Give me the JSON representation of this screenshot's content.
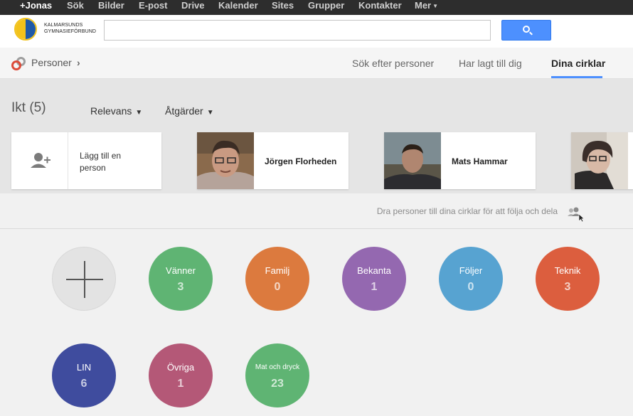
{
  "topnav": {
    "items": [
      {
        "label": "+Jonas",
        "active": true
      },
      {
        "label": "Sök"
      },
      {
        "label": "Bilder"
      },
      {
        "label": "E-post"
      },
      {
        "label": "Drive"
      },
      {
        "label": "Kalender"
      },
      {
        "label": "Sites"
      },
      {
        "label": "Grupper"
      },
      {
        "label": "Kontakter"
      },
      {
        "label": "Mer"
      }
    ]
  },
  "header": {
    "logo_line1": "KALMARSUNDS",
    "logo_line2": "GYMNASIEFÖRBUND",
    "search_value": "",
    "search_button_icon": "search-icon"
  },
  "subnav": {
    "section": "Personer",
    "tabs": [
      {
        "label": "Sök efter personer"
      },
      {
        "label": "Har lagt till dig"
      },
      {
        "label": "Dina cirklar",
        "selected": true
      }
    ]
  },
  "circle_view": {
    "title": "Ikt (5)",
    "sort_label": "Relevans",
    "actions_label": "Åtgärder",
    "add_person_label": "Lägg till en person",
    "people": [
      {
        "name": "Jörgen Florheden"
      },
      {
        "name": "Mats Hammar"
      },
      {
        "name": ""
      }
    ],
    "hint": "Dra personer till dina cirklar för att följa och dela"
  },
  "circles": [
    {
      "name": "Vänner",
      "count": "3",
      "color": "#5fb473"
    },
    {
      "name": "Familj",
      "count": "0",
      "color": "#dc7a3e"
    },
    {
      "name": "Bekanta",
      "count": "1",
      "color": "#9468b0"
    },
    {
      "name": "Följer",
      "count": "0",
      "color": "#57a3d1"
    },
    {
      "name": "Teknik",
      "count": "3",
      "color": "#dc5e3e"
    },
    {
      "name": "LIN",
      "count": "6",
      "color": "#3f4c9e"
    },
    {
      "name": "Övriga",
      "count": "1",
      "color": "#b45877"
    },
    {
      "name": "Mat och dryck",
      "count": "23",
      "color": "#5fb473"
    }
  ]
}
